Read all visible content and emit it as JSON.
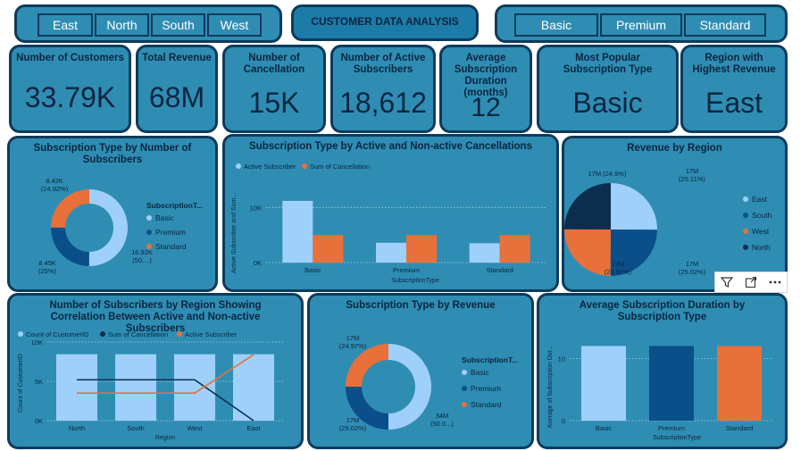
{
  "region_slicer": {
    "items": [
      "East",
      "North",
      "South",
      "West"
    ]
  },
  "report_title": "CUSTOMER DATA ANALYSIS",
  "subscription_slicer": {
    "items": [
      "Basic",
      "Premium",
      "Standard"
    ]
  },
  "kpis": [
    {
      "label": "Number of Customers",
      "value": "33.79K"
    },
    {
      "label": "Total Revenue",
      "value": "68M"
    },
    {
      "label": "Number of Cancellation",
      "value": "15K"
    },
    {
      "label": "Number of Active Subscribers",
      "value": "18,612"
    },
    {
      "label": "Average Subscription Duration (months)",
      "value": "12"
    },
    {
      "label": "Most Popular Subscription Type",
      "value": "Basic"
    },
    {
      "label": "Region with Highest Revenue",
      "value": "East"
    }
  ],
  "colors": {
    "basic": "#9fd0fb",
    "premium": "#0b4f8a",
    "standard": "#e8703a",
    "navy": "#0c2e4e",
    "panel": "#2f8db3",
    "border": "#0e3a5c"
  },
  "chart_data": [
    {
      "type": "pie",
      "title": "Subscription Type by Number of Subscribers",
      "legend_title": "SubscriptionT...",
      "legend_position": "right",
      "categories": [
        "Basic",
        "Premium",
        "Standard"
      ],
      "values": [
        16920,
        8450,
        8420
      ],
      "data_labels": [
        "16.92K\n(50....)",
        "8.45K\n(25%)",
        "8.42K\n(24.92%)"
      ]
    },
    {
      "type": "bar",
      "title": "Subscription Type by Active and Non-active Cancellations",
      "legend_position": "top-left",
      "xlabel": "SubscriptionType",
      "ylabel": "Active Subscriber and Sum...",
      "categories": [
        "Basic",
        "Premium",
        "Standard"
      ],
      "series": [
        {
          "name": "Active Subscriber",
          "values": [
            11200,
            3600,
            3500
          ]
        },
        {
          "name": "Sum of Cancellation",
          "values": [
            5000,
            5000,
            5000
          ]
        }
      ],
      "yticks": [
        "0K",
        "10K"
      ],
      "ylim": [
        0,
        12000
      ]
    },
    {
      "type": "pie",
      "title": "Revenue by Region",
      "legend_position": "right",
      "categories": [
        "East",
        "South",
        "West",
        "North"
      ],
      "values": [
        17060,
        17020,
        16980,
        16940
      ],
      "data_labels": [
        "17M\n(25.11%)",
        "17M\n(25.02%)",
        "17M\n(24.97%)",
        "17M (24.9%)"
      ]
    },
    {
      "type": "bar",
      "title": "Number of Subscribers by Region Showing Correlation Between Active and Non-active Subscribers",
      "legend_position": "top-left",
      "xlabel": "Region",
      "ylabel": "Count of CustomerID",
      "categories": [
        "North",
        "South",
        "West",
        "East"
      ],
      "series": [
        {
          "name": "Count of CustomerID",
          "values": [
            8450,
            8450,
            8450,
            8450
          ]
        },
        {
          "name": "Sum of Cancellation",
          "values": [
            5200,
            5200,
            5200,
            0
          ]
        },
        {
          "name": "Active Subscriber",
          "values": [
            3500,
            3500,
            3500,
            8400
          ]
        }
      ],
      "yticks": [
        "0K",
        "5K",
        "10K"
      ],
      "ylim": [
        0,
        10000
      ]
    },
    {
      "type": "pie",
      "title": "Subscription Type by Revenue",
      "legend_title": "SubscriptionT...",
      "legend_position": "right",
      "categories": [
        "Basic",
        "Premium",
        "Standard"
      ],
      "values": [
        34,
        17.01,
        16.99
      ],
      "data_labels": [
        "34M\n(50.0...)",
        "17M\n(25.02%)",
        "17M\n(24.97%)"
      ]
    },
    {
      "type": "bar",
      "title": "Average Subscription Duration by Subscription Type",
      "xlabel": "SubscriptionType",
      "ylabel": "Average of Subscription Dur...",
      "categories": [
        "Basic",
        "Premium",
        "Standard"
      ],
      "values": [
        12,
        12,
        12
      ],
      "yticks": [
        "0",
        "10"
      ],
      "ylim": [
        0,
        13.5
      ]
    }
  ],
  "visual_header": {
    "icons": [
      "filter-icon",
      "focus-mode-icon",
      "more-options-icon"
    ]
  }
}
